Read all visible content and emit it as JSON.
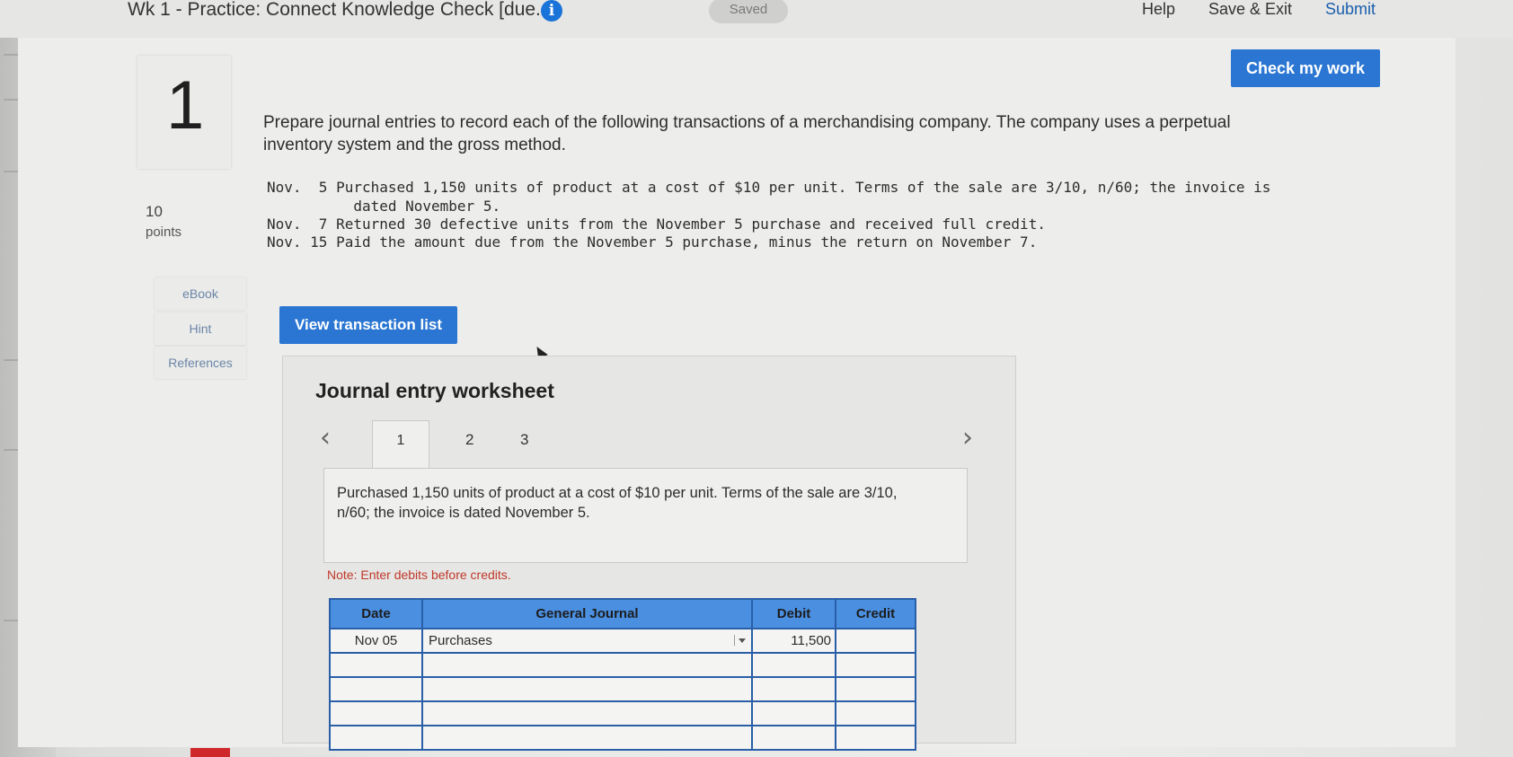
{
  "header": {
    "assignment_title": "Wk 1 - Practice: Connect Knowledge Check [due...",
    "status": "Saved",
    "help_label": "Help",
    "save_exit_label": "Save & Exit",
    "submit_label": "Submit"
  },
  "question": {
    "number": "1",
    "points_value": "10",
    "points_label": "points",
    "check_button": "Check my work",
    "prompt": "Prepare journal entries to record each of the following transactions of a merchandising company. The company uses a perpetual inventory system and the gross method.",
    "transactions": [
      "Nov.  5 Purchased 1,150 units of product at a cost of $10 per unit. Terms of the sale are 3/10, n/60; the invoice is",
      "          dated November 5.",
      "Nov.  7 Returned 30 defective units from the November 5 purchase and received full credit.",
      "Nov. 15 Paid the amount due from the November 5 purchase, minus the return on November 7."
    ]
  },
  "sidebar": {
    "tabs": [
      "eBook",
      "Hint",
      "References"
    ]
  },
  "worksheet": {
    "view_button": "View transaction list",
    "title": "Journal entry worksheet",
    "tabs": [
      "1",
      "2",
      "3"
    ],
    "active_tab": "1",
    "description": "Purchased 1,150 units of product at a cost of $10 per unit. Terms of the sale are 3/10, n/60; the invoice is dated November 5.",
    "note": "Note: Enter debits before credits.",
    "table": {
      "headers": [
        "Date",
        "General Journal",
        "Debit",
        "Credit"
      ],
      "rows": [
        {
          "date": "Nov 05",
          "account": "Purchases",
          "debit": "11,500",
          "credit": ""
        },
        {
          "date": "",
          "account": "",
          "debit": "",
          "credit": ""
        },
        {
          "date": "",
          "account": "",
          "debit": "",
          "credit": ""
        },
        {
          "date": "",
          "account": "",
          "debit": "",
          "credit": ""
        },
        {
          "date": "",
          "account": "",
          "debit": "",
          "credit": ""
        }
      ]
    }
  },
  "colors": {
    "primary_button": "#2a76d2",
    "table_header": "#4a8fe0",
    "note_text": "#c0392b",
    "submit_link": "#1b5fae"
  }
}
